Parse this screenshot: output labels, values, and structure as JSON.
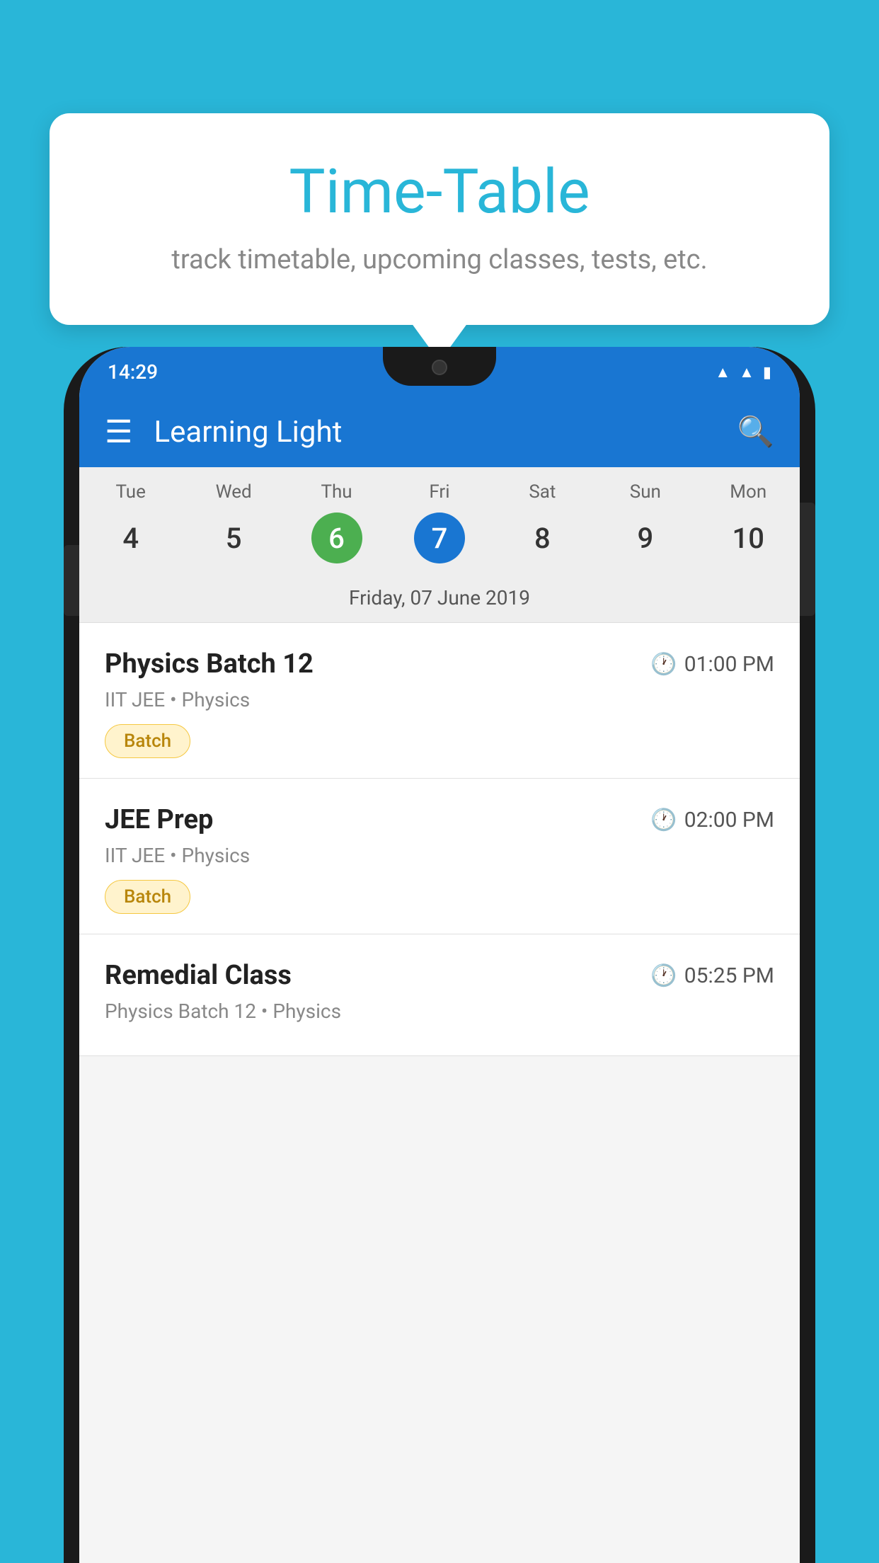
{
  "background_color": "#29b6d8",
  "tooltip": {
    "title": "Time-Table",
    "subtitle": "track timetable, upcoming classes, tests, etc."
  },
  "phone": {
    "status_bar": {
      "time": "14:29",
      "icons": [
        "wifi",
        "signal",
        "battery"
      ]
    },
    "app_bar": {
      "title": "Learning Light"
    },
    "calendar": {
      "days": [
        {
          "name": "Tue",
          "num": "4",
          "state": "normal"
        },
        {
          "name": "Wed",
          "num": "5",
          "state": "normal"
        },
        {
          "name": "Thu",
          "num": "6",
          "state": "today"
        },
        {
          "name": "Fri",
          "num": "7",
          "state": "selected"
        },
        {
          "name": "Sat",
          "num": "8",
          "state": "normal"
        },
        {
          "name": "Sun",
          "num": "9",
          "state": "normal"
        },
        {
          "name": "Mon",
          "num": "10",
          "state": "normal"
        }
      ],
      "selected_label": "Friday, 07 June 2019"
    },
    "schedule": [
      {
        "title": "Physics Batch 12",
        "time": "01:00 PM",
        "subtitle": "IIT JEE • Physics",
        "badge": "Batch"
      },
      {
        "title": "JEE Prep",
        "time": "02:00 PM",
        "subtitle": "IIT JEE • Physics",
        "badge": "Batch"
      },
      {
        "title": "Remedial Class",
        "time": "05:25 PM",
        "subtitle": "Physics Batch 12 • Physics",
        "badge": null
      }
    ]
  }
}
